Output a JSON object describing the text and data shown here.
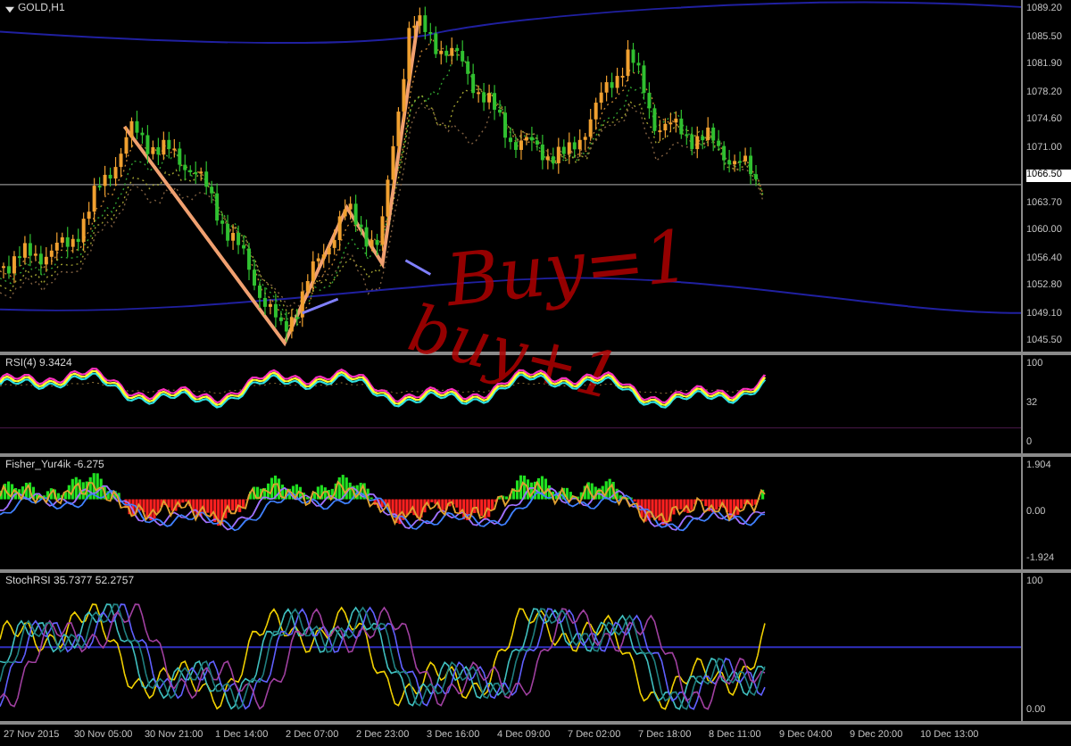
{
  "chart": {
    "symbol": "GOLD,H1",
    "price_labels": [
      {
        "text": "1089.20",
        "current": false
      },
      {
        "text": "1085.50",
        "current": false
      },
      {
        "text": "1081.90",
        "current": false
      },
      {
        "text": "1078.20",
        "current": false
      },
      {
        "text": "1074.60",
        "current": false
      },
      {
        "text": "1071.00",
        "current": false
      },
      {
        "text": "1066.50",
        "current": true
      },
      {
        "text": "1063.70",
        "current": false
      },
      {
        "text": "1060.00",
        "current": false
      },
      {
        "text": "1056.40",
        "current": false
      },
      {
        "text": "1052.80",
        "current": false
      },
      {
        "text": "1049.10",
        "current": false
      },
      {
        "text": "1045.50",
        "current": false
      }
    ]
  },
  "annotations": [
    "Buy=1",
    "buy+1"
  ],
  "panes": [
    {
      "kind": "rsi",
      "title": "RSI(4) 9.3424",
      "axis_labels": [
        "100",
        "32",
        "0"
      ]
    },
    {
      "kind": "fisher",
      "title": "Fisher_Yur4ik -6.275",
      "axis_labels": [
        "1.904",
        "0.00",
        "-1.924"
      ]
    },
    {
      "kind": "stoch",
      "title": "StochRSI 35.7377 52.2757",
      "axis_labels": [
        "100",
        "0.00"
      ]
    }
  ],
  "time_labels": [
    "27 Nov 2015",
    "30 Nov 05:00",
    "30 Nov 21:00",
    "1 Dec 14:00",
    "2 Dec 07:00",
    "2 Dec 23:00",
    "3 Dec 16:00",
    "4 Dec 09:00",
    "7 Dec 02:00",
    "7 Dec 18:00",
    "8 Dec 11:00",
    "9 Dec 04:00",
    "9 Dec 20:00",
    "10 Dec 13:00"
  ]
}
